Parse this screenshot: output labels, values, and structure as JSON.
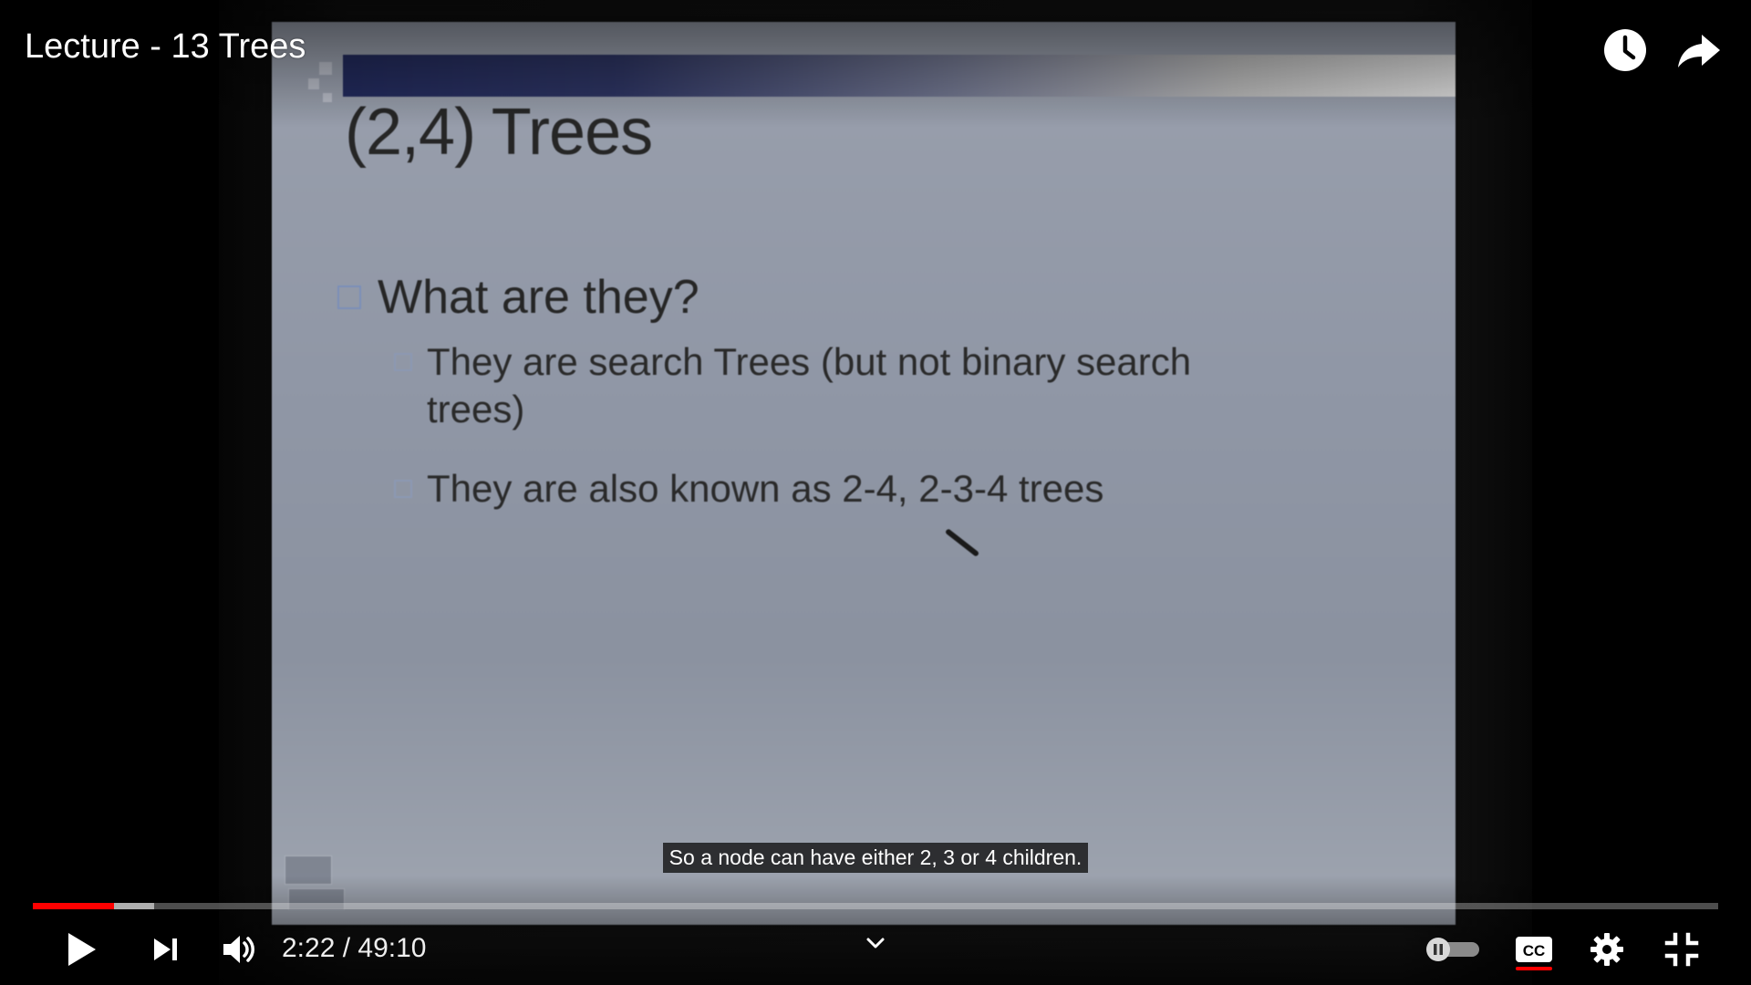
{
  "video": {
    "title": "Lecture - 13 Trees"
  },
  "slide": {
    "title": "(2,4) Trees",
    "bullet": "What are they?",
    "sub_bullet_1_line_1": "They are search Trees (but not binary search",
    "sub_bullet_1_line_2": "trees)",
    "sub_bullet_2": "They are also known as 2-4, 2-3-4 trees"
  },
  "caption": {
    "text": "So a node can have either 2, 3 or 4 children."
  },
  "player": {
    "current_time": "2:22",
    "duration": "49:10",
    "time_display": "2:22 / 49:10",
    "progress_fraction": 0.0481,
    "buffered_fraction": 0.072,
    "accent_color": "#ff0000",
    "autoplay_state": "paused"
  },
  "icons": {
    "watch_later": "clock-icon",
    "share": "share-arrow-icon",
    "play": "play-icon",
    "next": "next-icon",
    "volume": "volume-icon",
    "chapters": "chevron-down-icon",
    "autoplay": "autoplay-toggle-icon",
    "captions": "cc-icon",
    "settings": "gear-icon",
    "fullscreen_exit": "exit-fullscreen-icon"
  }
}
